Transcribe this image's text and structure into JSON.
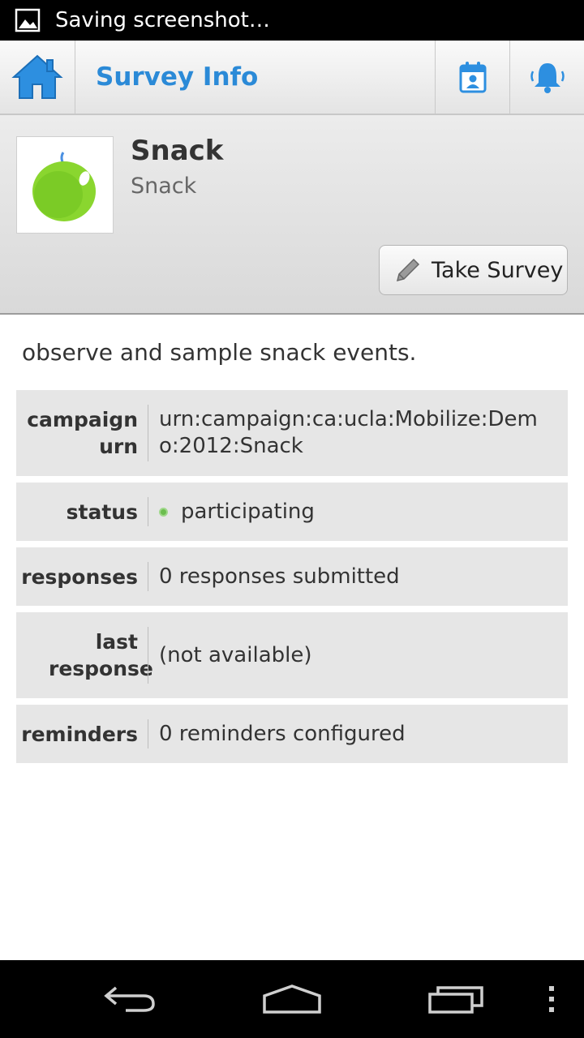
{
  "status_bar": {
    "notification_text": "Saving screenshot…",
    "icon": "image-icon"
  },
  "action_bar": {
    "title": "Survey Info",
    "home_icon": "home-icon",
    "buttons": [
      "calendar-person-icon",
      "bell-icon"
    ]
  },
  "campaign": {
    "title": "Snack",
    "subtitle": "Snack",
    "logo_icon": "green-apple-icon",
    "take_survey_label": "Take Survey",
    "description": "observe and sample snack events."
  },
  "details": [
    {
      "key": "campaign urn",
      "value": "urn:campaign:ca:ucla:Mobilize:Demo:2012:Snack"
    },
    {
      "key": "status",
      "value": "participating",
      "status_color": "#6bbd4e"
    },
    {
      "key": "responses",
      "value": "0 responses submitted"
    },
    {
      "key": "last response",
      "value": "(not available)"
    },
    {
      "key": "reminders",
      "value": "0 reminders configured"
    }
  ],
  "nav_bar": [
    "back-icon",
    "home-icon",
    "recent-apps-icon",
    "overflow-menu-icon"
  ],
  "colors": {
    "accent": "#2b8ad7",
    "status_bar": "#000000"
  }
}
